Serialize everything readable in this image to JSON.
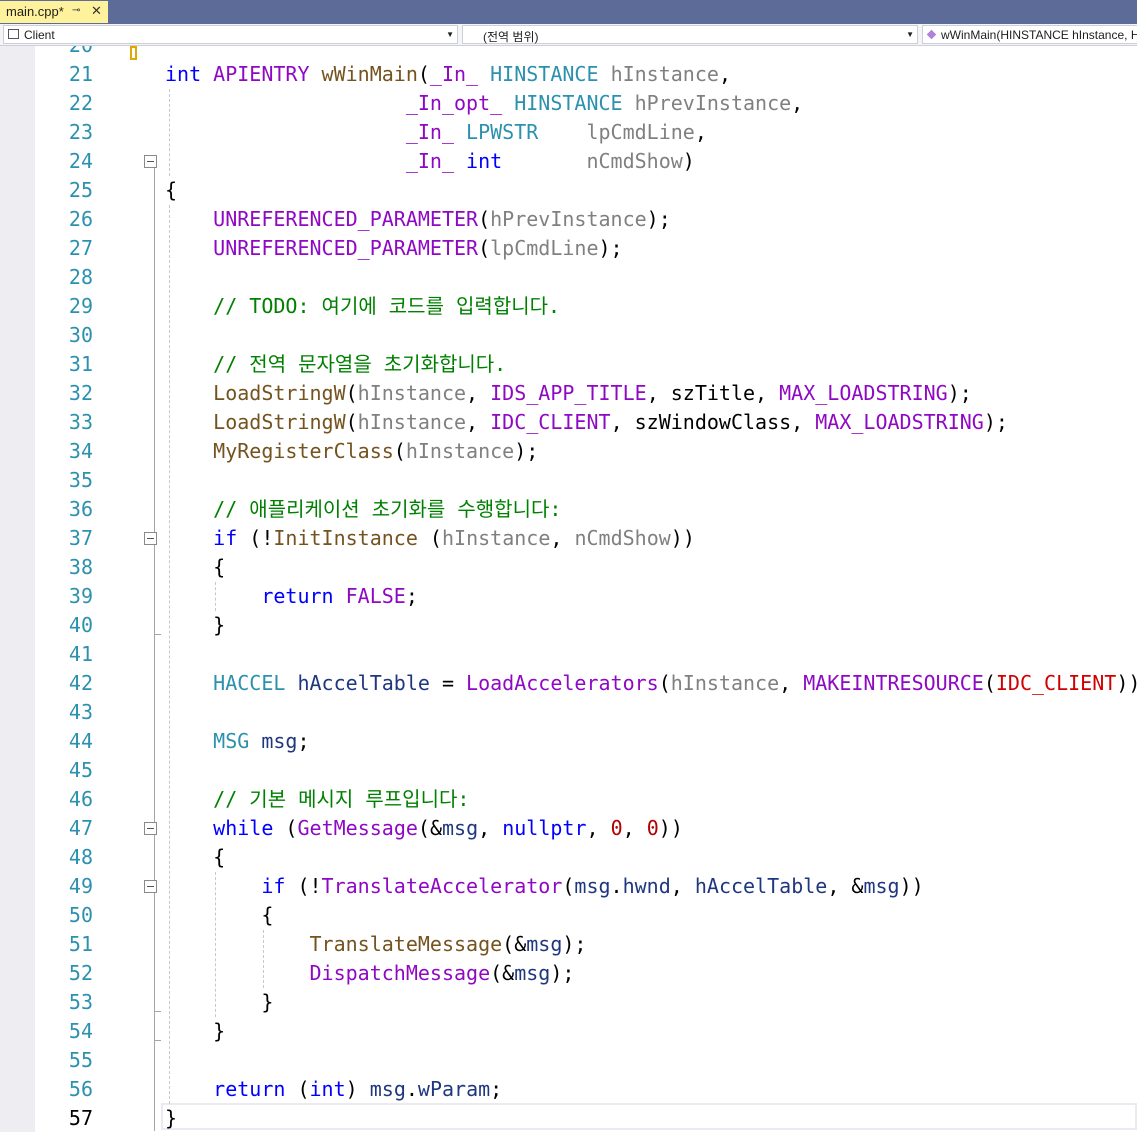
{
  "tab": {
    "name": "main.cpp*",
    "pin": "⊸",
    "close": "✕"
  },
  "nav": {
    "project": "Client",
    "scope": "(전역 범위)",
    "member": "wWinMain(HINSTANCE hInstance, H"
  },
  "editor": {
    "first_partial_line": 20,
    "current_line": 57,
    "lines": [
      {
        "n": "21",
        "tokens": [
          [
            "kw",
            "int"
          ],
          [
            "plain",
            " "
          ],
          [
            "mac",
            "APIENTRY"
          ],
          [
            "plain",
            " "
          ],
          [
            "fn",
            "wWinMain"
          ],
          [
            "plain",
            "("
          ],
          [
            "mac",
            "_In_"
          ],
          [
            "plain",
            " "
          ],
          [
            "ty",
            "HINSTANCE"
          ],
          [
            "plain",
            " "
          ],
          [
            "par",
            "hInstance"
          ],
          [
            "plain",
            ","
          ]
        ]
      },
      {
        "n": "22",
        "tokens": [
          [
            "plain",
            "                    "
          ],
          [
            "mac",
            "_In_opt_"
          ],
          [
            "plain",
            " "
          ],
          [
            "ty",
            "HINSTANCE"
          ],
          [
            "plain",
            " "
          ],
          [
            "par",
            "hPrevInstance"
          ],
          [
            "plain",
            ","
          ]
        ]
      },
      {
        "n": "23",
        "tokens": [
          [
            "plain",
            "                    "
          ],
          [
            "mac",
            "_In_"
          ],
          [
            "plain",
            " "
          ],
          [
            "ty",
            "LPWSTR"
          ],
          [
            "plain",
            "    "
          ],
          [
            "par",
            "lpCmdLine"
          ],
          [
            "plain",
            ","
          ]
        ]
      },
      {
        "n": "24",
        "tokens": [
          [
            "plain",
            "                    "
          ],
          [
            "mac",
            "_In_"
          ],
          [
            "plain",
            " "
          ],
          [
            "kw",
            "int"
          ],
          [
            "plain",
            "       "
          ],
          [
            "par",
            "nCmdShow"
          ],
          [
            "plain",
            ")"
          ]
        ]
      },
      {
        "n": "25",
        "tokens": [
          [
            "plain",
            "{"
          ]
        ]
      },
      {
        "n": "26",
        "tokens": [
          [
            "plain",
            "    "
          ],
          [
            "mac",
            "UNREFERENCED_PARAMETER"
          ],
          [
            "plain",
            "("
          ],
          [
            "par",
            "hPrevInstance"
          ],
          [
            "plain",
            ");"
          ]
        ]
      },
      {
        "n": "27",
        "tokens": [
          [
            "plain",
            "    "
          ],
          [
            "mac",
            "UNREFERENCED_PARAMETER"
          ],
          [
            "plain",
            "("
          ],
          [
            "par",
            "lpCmdLine"
          ],
          [
            "plain",
            ");"
          ]
        ]
      },
      {
        "n": "28",
        "tokens": []
      },
      {
        "n": "29",
        "tokens": [
          [
            "plain",
            "    "
          ],
          [
            "cm",
            "// TODO: 여기에 코드를 입력합니다."
          ]
        ]
      },
      {
        "n": "30",
        "tokens": []
      },
      {
        "n": "31",
        "tokens": [
          [
            "plain",
            "    "
          ],
          [
            "cm",
            "// 전역 문자열을 초기화합니다."
          ]
        ]
      },
      {
        "n": "32",
        "tokens": [
          [
            "plain",
            "    "
          ],
          [
            "fn",
            "LoadStringW"
          ],
          [
            "plain",
            "("
          ],
          [
            "par",
            "hInstance"
          ],
          [
            "plain",
            ", "
          ],
          [
            "mac",
            "IDS_APP_TITLE"
          ],
          [
            "plain",
            ", szTitle, "
          ],
          [
            "mac",
            "MAX_LOADSTRING"
          ],
          [
            "plain",
            ");"
          ]
        ]
      },
      {
        "n": "33",
        "tokens": [
          [
            "plain",
            "    "
          ],
          [
            "fn",
            "LoadStringW"
          ],
          [
            "plain",
            "("
          ],
          [
            "par",
            "hInstance"
          ],
          [
            "plain",
            ", "
          ],
          [
            "mac",
            "IDC_CLIENT"
          ],
          [
            "plain",
            ", szWindowClass, "
          ],
          [
            "mac",
            "MAX_LOADSTRING"
          ],
          [
            "plain",
            ");"
          ]
        ]
      },
      {
        "n": "34",
        "tokens": [
          [
            "plain",
            "    "
          ],
          [
            "fn",
            "MyRegisterClass"
          ],
          [
            "plain",
            "("
          ],
          [
            "par",
            "hInstance"
          ],
          [
            "plain",
            ");"
          ]
        ]
      },
      {
        "n": "35",
        "tokens": []
      },
      {
        "n": "36",
        "tokens": [
          [
            "plain",
            "    "
          ],
          [
            "cm",
            "// 애플리케이션 초기화를 수행합니다:"
          ]
        ]
      },
      {
        "n": "37",
        "tokens": [
          [
            "plain",
            "    "
          ],
          [
            "kw",
            "if"
          ],
          [
            "plain",
            " (!"
          ],
          [
            "fn",
            "InitInstance"
          ],
          [
            "plain",
            " ("
          ],
          [
            "par",
            "hInstance"
          ],
          [
            "plain",
            ", "
          ],
          [
            "par",
            "nCmdShow"
          ],
          [
            "plain",
            "))"
          ]
        ]
      },
      {
        "n": "38",
        "tokens": [
          [
            "plain",
            "    {"
          ]
        ]
      },
      {
        "n": "39",
        "tokens": [
          [
            "plain",
            "        "
          ],
          [
            "kw",
            "return"
          ],
          [
            "plain",
            " "
          ],
          [
            "mac",
            "FALSE"
          ],
          [
            "plain",
            ";"
          ]
        ]
      },
      {
        "n": "40",
        "tokens": [
          [
            "plain",
            "    }"
          ]
        ]
      },
      {
        "n": "41",
        "tokens": []
      },
      {
        "n": "42",
        "tokens": [
          [
            "plain",
            "    "
          ],
          [
            "ty",
            "HACCEL"
          ],
          [
            "plain",
            " "
          ],
          [
            "loc",
            "hAccelTable"
          ],
          [
            "plain",
            " = "
          ],
          [
            "mac",
            "LoadAccelerators"
          ],
          [
            "plain",
            "("
          ],
          [
            "par",
            "hInstance"
          ],
          [
            "plain",
            ", "
          ],
          [
            "mac",
            "MAKEINTRESOURCE"
          ],
          [
            "plain",
            "("
          ],
          [
            "res",
            "IDC_CLIENT"
          ],
          [
            "plain",
            "));"
          ]
        ]
      },
      {
        "n": "43",
        "tokens": []
      },
      {
        "n": "44",
        "tokens": [
          [
            "plain",
            "    "
          ],
          [
            "ty",
            "MSG"
          ],
          [
            "plain",
            " "
          ],
          [
            "loc",
            "msg"
          ],
          [
            "plain",
            ";"
          ]
        ]
      },
      {
        "n": "45",
        "tokens": []
      },
      {
        "n": "46",
        "tokens": [
          [
            "plain",
            "    "
          ],
          [
            "cm",
            "// 기본 메시지 루프입니다:"
          ]
        ]
      },
      {
        "n": "47",
        "tokens": [
          [
            "plain",
            "    "
          ],
          [
            "kw",
            "while"
          ],
          [
            "plain",
            " ("
          ],
          [
            "mac",
            "GetMessage"
          ],
          [
            "plain",
            "(&"
          ],
          [
            "loc",
            "msg"
          ],
          [
            "plain",
            ", "
          ],
          [
            "kw",
            "nullptr"
          ],
          [
            "plain",
            ", "
          ],
          [
            "num",
            "0"
          ],
          [
            "plain",
            ", "
          ],
          [
            "num",
            "0"
          ],
          [
            "plain",
            "))"
          ]
        ]
      },
      {
        "n": "48",
        "tokens": [
          [
            "plain",
            "    {"
          ]
        ]
      },
      {
        "n": "49",
        "tokens": [
          [
            "plain",
            "        "
          ],
          [
            "kw",
            "if"
          ],
          [
            "plain",
            " (!"
          ],
          [
            "mac",
            "TranslateAccelerator"
          ],
          [
            "plain",
            "("
          ],
          [
            "loc",
            "msg"
          ],
          [
            "plain",
            "."
          ],
          [
            "loc",
            "hwnd"
          ],
          [
            "plain",
            ", "
          ],
          [
            "loc",
            "hAccelTable"
          ],
          [
            "plain",
            ", &"
          ],
          [
            "loc",
            "msg"
          ],
          [
            "plain",
            "))"
          ]
        ]
      },
      {
        "n": "50",
        "tokens": [
          [
            "plain",
            "        {"
          ]
        ]
      },
      {
        "n": "51",
        "tokens": [
          [
            "plain",
            "            "
          ],
          [
            "fn",
            "TranslateMessage"
          ],
          [
            "plain",
            "(&"
          ],
          [
            "loc",
            "msg"
          ],
          [
            "plain",
            ");"
          ]
        ]
      },
      {
        "n": "52",
        "tokens": [
          [
            "plain",
            "            "
          ],
          [
            "mac",
            "DispatchMessage"
          ],
          [
            "plain",
            "(&"
          ],
          [
            "loc",
            "msg"
          ],
          [
            "plain",
            ");"
          ]
        ]
      },
      {
        "n": "53",
        "tokens": [
          [
            "plain",
            "        }"
          ]
        ]
      },
      {
        "n": "54",
        "tokens": [
          [
            "plain",
            "    }"
          ]
        ]
      },
      {
        "n": "55",
        "tokens": []
      },
      {
        "n": "56",
        "tokens": [
          [
            "plain",
            "    "
          ],
          [
            "kw",
            "return"
          ],
          [
            "plain",
            " ("
          ],
          [
            "kw",
            "int"
          ],
          [
            "plain",
            ") "
          ],
          [
            "loc",
            "msg"
          ],
          [
            "plain",
            "."
          ],
          [
            "loc",
            "wParam"
          ],
          [
            "plain",
            ";"
          ]
        ]
      },
      {
        "n": "57",
        "tokens": [
          [
            "plain",
            "}"
          ]
        ]
      }
    ]
  }
}
